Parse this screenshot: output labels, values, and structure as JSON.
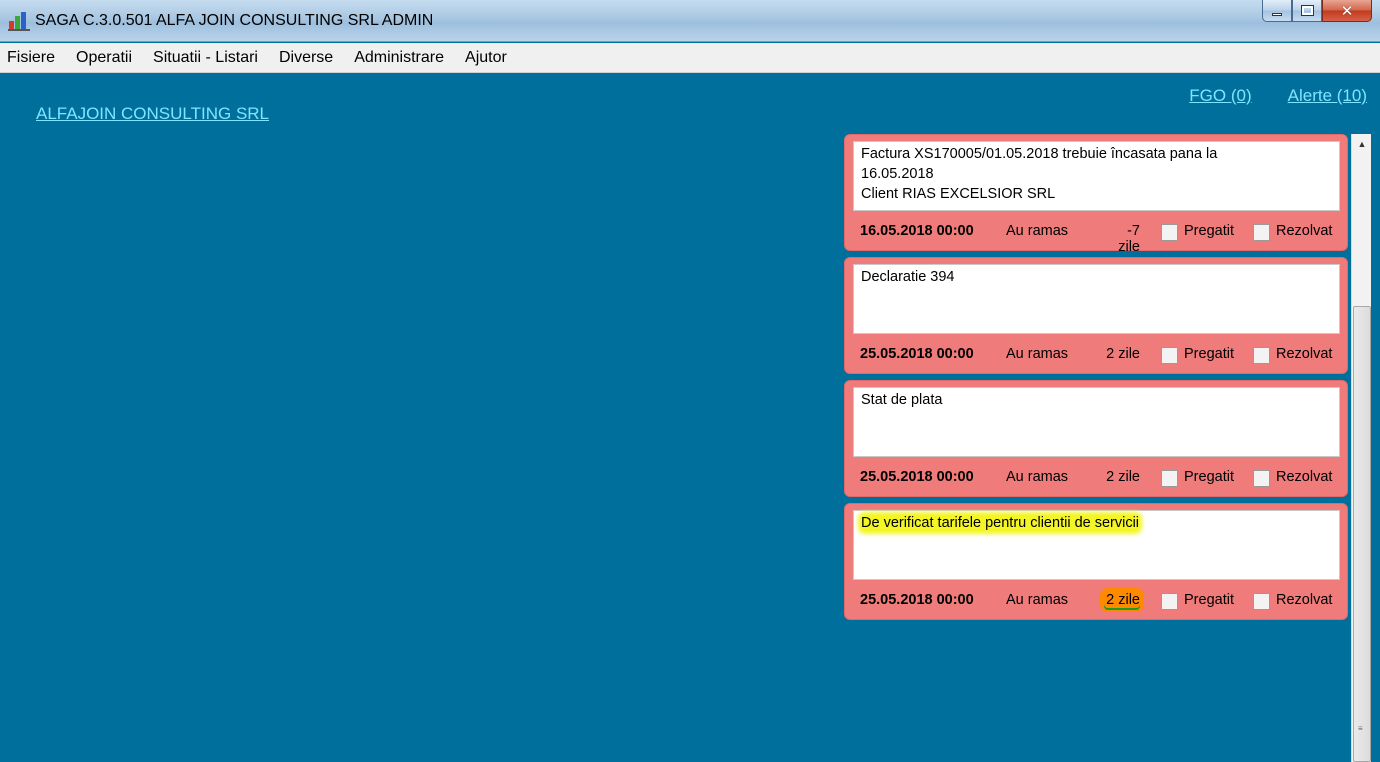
{
  "window": {
    "title": "SAGA C.3.0.501  ALFA JOIN CONSULTING SRL  ADMIN",
    "close_glyph": "✕"
  },
  "menu": [
    "Fisiere",
    "Operatii",
    "Situatii - Listari",
    "Diverse",
    "Administrare",
    "Ajutor"
  ],
  "company_link": "ALFAJOIN CONSULTING SRL",
  "top_links": {
    "fgo": "FGO (0)",
    "alerte": "Alerte (10)"
  },
  "alerts": [
    {
      "text": "Factura XS170005/01.05.2018 trebuie încasata pana la\n16.05.2018\nClient RIAS EXCELSIOR SRL",
      "date": "16.05.2018 00:00",
      "remaining_label": "Au ramas",
      "days": "-7 zile",
      "pregatit": "Pregatit",
      "rezolvat": "Rezolvat"
    },
    {
      "text": "Declaratie 394",
      "date": "25.05.2018 00:00",
      "remaining_label": "Au ramas",
      "days": "2 zile",
      "pregatit": "Pregatit",
      "rezolvat": "Rezolvat"
    },
    {
      "text": "Stat de plata",
      "date": "25.05.2018 00:00",
      "remaining_label": "Au ramas",
      "days": "2 zile",
      "pregatit": "Pregatit",
      "rezolvat": "Rezolvat"
    },
    {
      "text": "De verificat tarifele pentru clientii de servicii",
      "date": "25.05.2018 00:00",
      "remaining_label": "Au ramas",
      "days": "2 zile",
      "pregatit": "Pregatit",
      "rezolvat": "Rezolvat"
    }
  ],
  "colors": {
    "background": "#006f9b",
    "alert_card": "#f07b7b",
    "link": "#7fe4ff",
    "highlight_yellow": "#f3f526",
    "highlight_orange": "#ff8a00"
  }
}
